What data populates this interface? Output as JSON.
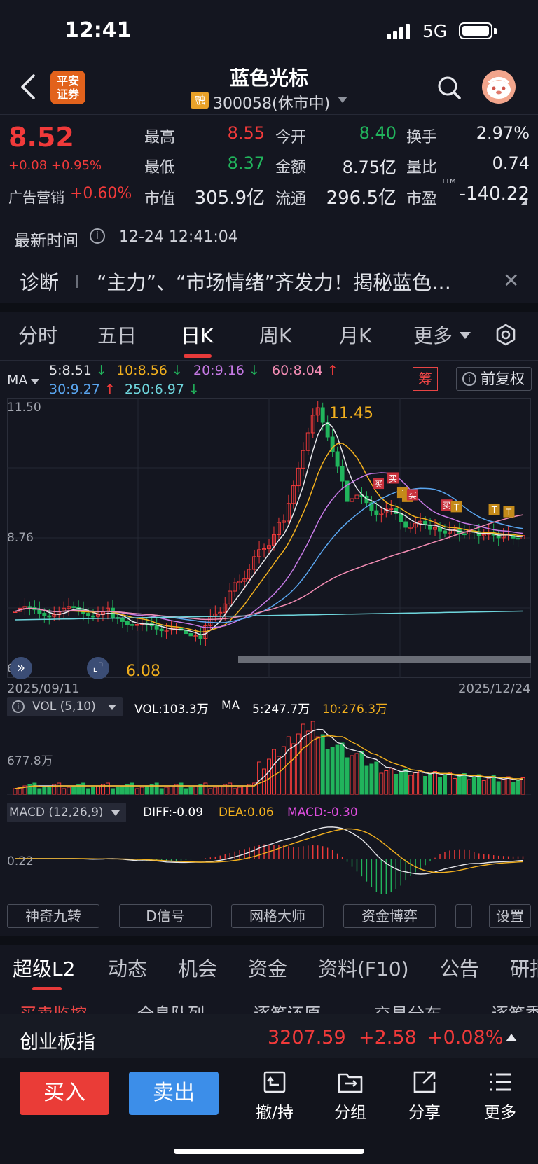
{
  "status": {
    "time": "12:41",
    "network": "5G"
  },
  "header": {
    "broker_logo": "平安证券",
    "name": "蓝色光标",
    "badge": "融",
    "code": "300058(休市中)"
  },
  "quote": {
    "price": "8.52",
    "change": "+0.08 +0.95%",
    "sector": "广告营销",
    "sector_change": "+0.60%",
    "high_label": "最高",
    "high": "8.55",
    "open_label": "今开",
    "open": "8.40",
    "turnover_label": "换手",
    "turnover": "2.97%",
    "low_label": "最低",
    "low": "8.37",
    "amount_label": "金额",
    "amount": "8.75亿",
    "ratio_label": "量比",
    "ratio": "0.74",
    "mcap_label": "市值",
    "mcap": "305.9亿",
    "float_label": "流通",
    "float": "296.5亿",
    "pe_label": "市盈",
    "pe_sup": "TTM",
    "pe": "-140.22",
    "latest_label": "最新时间",
    "latest_time": "12-24 12:41:04"
  },
  "diagnosis": {
    "label": "诊断",
    "text": "“主力”、“市场情绪”齐发力！揭秘蓝色…"
  },
  "period_tabs": [
    "分时",
    "五日",
    "日K",
    "周K",
    "月K",
    "更多"
  ],
  "ma": {
    "label": "MA",
    "ma5": "5:8.51",
    "ma10": "10:8.56",
    "ma20": "20:9.16",
    "ma60": "60:8.04",
    "ma30": "30:9.27",
    "ma250": "250:6.97",
    "chip": "筹",
    "adjust": "前复权"
  },
  "kchart_axis": {
    "top": "11.50",
    "mid": "8.76",
    "bottom": "6.0",
    "high_mark": "11.45",
    "low_mark": "6.08",
    "date_start": "2025/09/11",
    "date_end": "2025/12/24"
  },
  "signal_labels": {
    "buy": "买",
    "t": "T"
  },
  "vol": {
    "title": "VOL (5,10)",
    "vol": "VOL:103.3万",
    "ma_label": "MA",
    "ma5": "5:247.7万",
    "ma10": "10:276.3万",
    "axis": "677.8万"
  },
  "macd": {
    "title": "MACD (12,26,9)",
    "diff": "DIFF:-0.09",
    "dea": "DEA:0.06",
    "macd": "MACD:-0.30",
    "axis": "0.22"
  },
  "tools": [
    "神奇九转",
    "D信号",
    "网格大师",
    "资金博弈",
    "设置"
  ],
  "bottom_tabs": [
    "超级L2",
    "动态",
    "机会",
    "资金",
    "资料(F10)",
    "公告",
    "研报"
  ],
  "sub_tabs": [
    "买卖监控",
    "全息队列",
    "逐笔还原",
    "交易分布",
    "逐笔委"
  ],
  "index": {
    "name": "创业板指",
    "value": "3207.59",
    "change": "+2.58",
    "pct": "+0.08%"
  },
  "actions": {
    "buy": "买入",
    "sell": "卖出",
    "hold": "撤/持",
    "group": "分组",
    "share": "分享",
    "more": "更多"
  },
  "colors": {
    "up": "#f13a3a",
    "down": "#21b45c",
    "ma5": "#e6e6ea",
    "ma10": "#f2b01e",
    "ma20": "#c77ae6",
    "ma30": "#5aa6f0",
    "ma60": "#f58db5",
    "ma250": "#6fd6dd"
  }
}
